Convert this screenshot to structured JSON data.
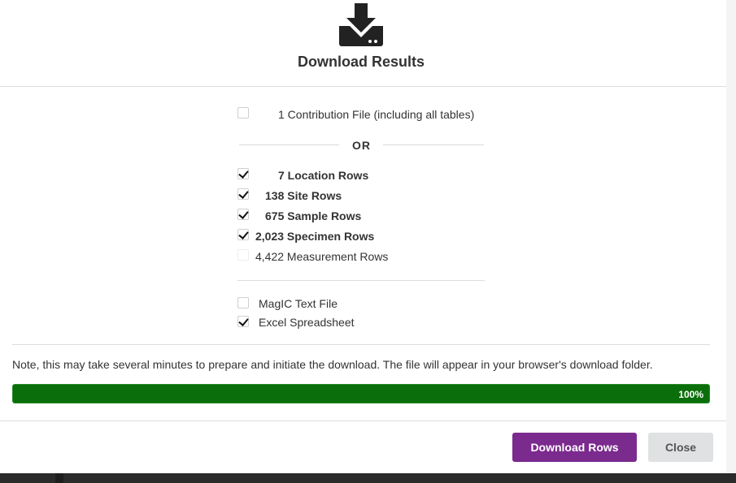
{
  "modal": {
    "title": "Download Results",
    "contribution": {
      "label": "1 Contribution File (including all tables)",
      "checked": false
    },
    "or_label": "OR",
    "rows": [
      {
        "label": "7 Location Rows",
        "checked": true,
        "bold": true
      },
      {
        "label": "138 Site Rows",
        "checked": true,
        "bold": true
      },
      {
        "label": "675 Sample Rows",
        "checked": true,
        "bold": true
      },
      {
        "label": "2,023 Specimen Rows",
        "checked": true,
        "bold": true
      },
      {
        "label": "4,422 Measurement Rows",
        "checked": false,
        "bold": false
      }
    ],
    "formats": [
      {
        "label": "MagIC Text File",
        "checked": false
      },
      {
        "label": "Excel Spreadsheet",
        "checked": true
      }
    ],
    "note": "Note, this may take several minutes to prepare and initiate the download. The file will appear in your browser's download folder.",
    "progress": {
      "value": 100,
      "label": "100%",
      "color": "#0a6e0a"
    },
    "buttons": {
      "download": "Download Rows",
      "close": "Close"
    },
    "colors": {
      "primary": "#7b2a8e",
      "secondary": "#e0e1e2"
    }
  }
}
